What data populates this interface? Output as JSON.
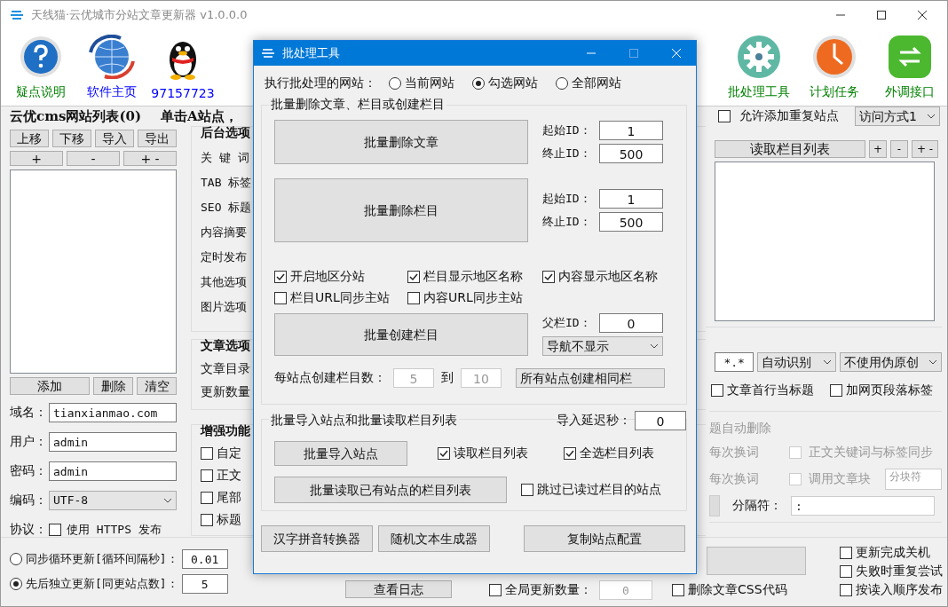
{
  "window": {
    "title": "天线猫·云优城市分站文章更新器 v1.0.0.0"
  },
  "toolbar": {
    "left": [
      {
        "label": "疑点说明",
        "kind": "help",
        "color": "#008000"
      },
      {
        "label": "软件主页",
        "kind": "globe",
        "color": "#0000ff"
      },
      {
        "label": "97157723",
        "kind": "penguin",
        "color": "#0000ff"
      }
    ],
    "right": [
      {
        "label": "批处理工具",
        "kind": "gear",
        "color": "#008000"
      },
      {
        "label": "计划任务",
        "kind": "clock",
        "color": "#008000"
      },
      {
        "label": "外调接口",
        "kind": "exchange",
        "color": "#008000"
      }
    ]
  },
  "site_list": {
    "title": "云优cms网站列表(0)",
    "hint": "单击A站点，",
    "move_buttons": [
      "上移",
      "下移",
      "导入",
      "导出"
    ],
    "plus_buttons": [
      "+",
      "-",
      "+ -"
    ],
    "action_buttons": [
      "添加",
      "删除",
      "清空"
    ],
    "fields": [
      {
        "label": "域名：",
        "value": "tianxianmao.com"
      },
      {
        "label": "用户：",
        "value": "admin"
      },
      {
        "label": "密码：",
        "value": "admin"
      }
    ],
    "encoding": {
      "label": "编码：",
      "value": "UTF-8"
    },
    "protocol": {
      "label": "协议：",
      "option": "使用 HTTPS 发布",
      "checked": false
    }
  },
  "backend_options": {
    "title": "后台选项",
    "labels": [
      "关 键 词",
      "TAB 标签",
      "SEO 标题",
      "内容摘要",
      "定时发布",
      "其他选项",
      "图片选项"
    ]
  },
  "article_options": {
    "title": "文章选项",
    "labels": [
      "文章目录",
      "更新数量"
    ]
  },
  "enhance": {
    "title": "增强功能",
    "items": [
      {
        "label": "自定",
        "checked": false
      },
      {
        "label": "正文",
        "checked": false
      },
      {
        "label": "尾部",
        "checked": false
      },
      {
        "label": "标题",
        "checked": false
      }
    ]
  },
  "right_panel": {
    "allow_duplicate": {
      "label": "允许添加重复站点",
      "checked": false
    },
    "access_mode": "访问方式1",
    "read_button": "读取栏目列表",
    "plus_buttons": [
      "+",
      "-",
      "+ -"
    ],
    "pattern": "*.*",
    "encoding_mode": "自动识别",
    "rewrite_mode": "不使用伪原创",
    "checks": [
      {
        "label": "文章首行当标题",
        "checked": false
      },
      {
        "label": "加网页段落标签",
        "checked": false
      }
    ]
  },
  "right_group": {
    "partial": "题自动删除",
    "words": [
      "每次换词",
      "每次换词"
    ],
    "checks": [
      {
        "label": "正文关键词与标签同步",
        "checked": false,
        "disabled": true
      },
      {
        "label": "调用文章块",
        "checked": false,
        "disabled": true
      }
    ],
    "block_field": "分块符",
    "separator_label": "分隔符：",
    "separator_value": ":"
  },
  "bottom": {
    "modes": [
      {
        "label": "同步循环更新[循环间隔秒]：",
        "value": "0.01",
        "selected": false
      },
      {
        "label": "先后独立更新[同更站点数]：",
        "value": "5",
        "selected": true
      }
    ],
    "log_button": "查看日志",
    "global_count": {
      "label": "全局更新数量：",
      "checked": false,
      "value": "0",
      "disabled": true
    },
    "delete_css": {
      "label": "删除文章CSS代码",
      "checked": false
    },
    "end_options": [
      {
        "label": "更新完成关机",
        "checked": false
      },
      {
        "label": "失败时重复尝试",
        "checked": false
      },
      {
        "label": "按读入顺序发布",
        "checked": false
      }
    ]
  },
  "dialog": {
    "title": "批处理工具",
    "target_label": "执行批处理的网站：",
    "targets": [
      {
        "label": "当前网站",
        "selected": false
      },
      {
        "label": "勾选网站",
        "selected": true
      },
      {
        "label": "全部网站",
        "selected": false
      }
    ],
    "group1": {
      "title": "批量删除文章、栏目或创建栏目",
      "deletes": [
        {
          "button": "批量删除文章",
          "start_label": "起始ID：",
          "start": "1",
          "end_label": "终止ID：",
          "end": "500"
        },
        {
          "button": "批量删除栏目",
          "start_label": "起始ID：",
          "start": "1",
          "end_label": "终止ID：",
          "end": "500"
        }
      ],
      "checks": [
        {
          "label": "开启地区分站",
          "checked": true
        },
        {
          "label": "栏目显示地区名称",
          "checked": true
        },
        {
          "label": "内容显示地区名称",
          "checked": true
        },
        {
          "label": "栏目URL同步主站",
          "checked": false
        },
        {
          "label": "内容URL同步主站",
          "checked": false
        }
      ],
      "create_button": "批量创建栏目",
      "parent_label": "父栏ID：",
      "parent": "0",
      "nav": "导航不显示",
      "count_label": "每站点创建栏目数：",
      "count_from": "5",
      "to_label": "到",
      "count_to": "10",
      "counts_disabled": true,
      "mode": "所有站点创建相同栏"
    },
    "group2": {
      "title": "批量导入站点和批量读取栏目列表",
      "delay_label": "导入延迟秒：",
      "delay": "0",
      "import_button": "批量导入站点",
      "checks": [
        {
          "label": "读取栏目列表",
          "checked": true
        },
        {
          "label": "全选栏目列表",
          "checked": true
        }
      ],
      "read_button": "批量读取已有站点的栏目列表",
      "skip": {
        "label": "跳过已读过栏目的站点",
        "checked": false
      }
    },
    "buttons": [
      "汉字拼音转换器",
      "随机文本生成器",
      "复制站点配置"
    ]
  }
}
